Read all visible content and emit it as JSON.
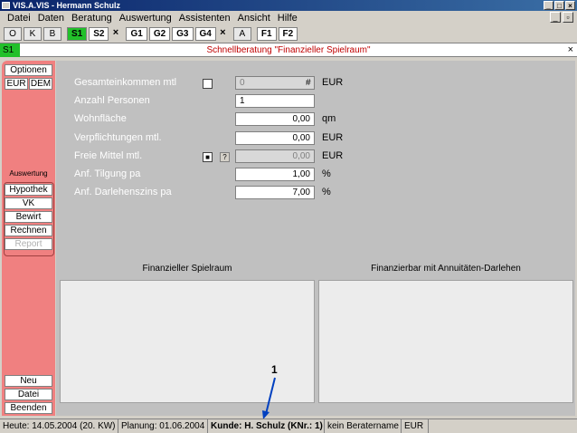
{
  "window": {
    "title": "VIS.A.VIS - Hermann Schulz"
  },
  "menu": [
    "Datei",
    "Daten",
    "Beratung",
    "Auswertung",
    "Assistenten",
    "Ansicht",
    "Hilfe"
  ],
  "toolbar": {
    "o": "O",
    "k": "K",
    "b": "B",
    "s1": "S1",
    "s2": "S2",
    "g1": "G1",
    "g2": "G2",
    "g3": "G3",
    "g4": "G4",
    "a": "A",
    "f1": "F1",
    "f2": "F2",
    "close": "×"
  },
  "header": {
    "tag": "S1",
    "title": "Schnellberatung \"Finanzieller Spielraum\""
  },
  "sidebar": {
    "optionen": "Optionen",
    "eur": "EUR",
    "dem": "DEM",
    "auswertung_label": "Auswertung",
    "hypothek": "Hypothek",
    "vk": "VK",
    "bewirt": "Bewirt",
    "rechnen": "Rechnen",
    "report": "Report",
    "neu": "Neu",
    "datei": "Datei",
    "beenden": "Beenden"
  },
  "form": {
    "gesamteinkommen": {
      "label": "Gesamteinkommen mtl",
      "value": "0",
      "unit": "EUR",
      "hash": "#"
    },
    "personen": {
      "label": "Anzahl Personen",
      "value": "1"
    },
    "wohnflaeche": {
      "label": "Wohnfläche",
      "value": "0,00",
      "unit": "qm"
    },
    "verpflichtungen": {
      "label": "Verpflichtungen mtl.",
      "value": "0,00",
      "unit": "EUR"
    },
    "freie_mittel": {
      "label": "Freie Mittel mtl.",
      "value": "0,00",
      "unit": "EUR",
      "help": "?"
    },
    "tilgung": {
      "label": "Anf. Tilgung pa",
      "value": "1,00",
      "unit": "%"
    },
    "zins": {
      "label": "Anf. Darlehenszins pa",
      "value": "7,00",
      "unit": "%"
    }
  },
  "panels": {
    "left_title": "Finanzieller Spielraum",
    "right_title": "Finanzierbar mit Annuitäten-Darlehen"
  },
  "callout": "1",
  "status": {
    "heute": "Heute: 14.05.2004 (20. KW)",
    "planung": "Planung: 01.06.2004",
    "kunde": "Kunde: H. Schulz (KNr.: 1)",
    "berater": "kein Beratername",
    "currency": "EUR"
  }
}
